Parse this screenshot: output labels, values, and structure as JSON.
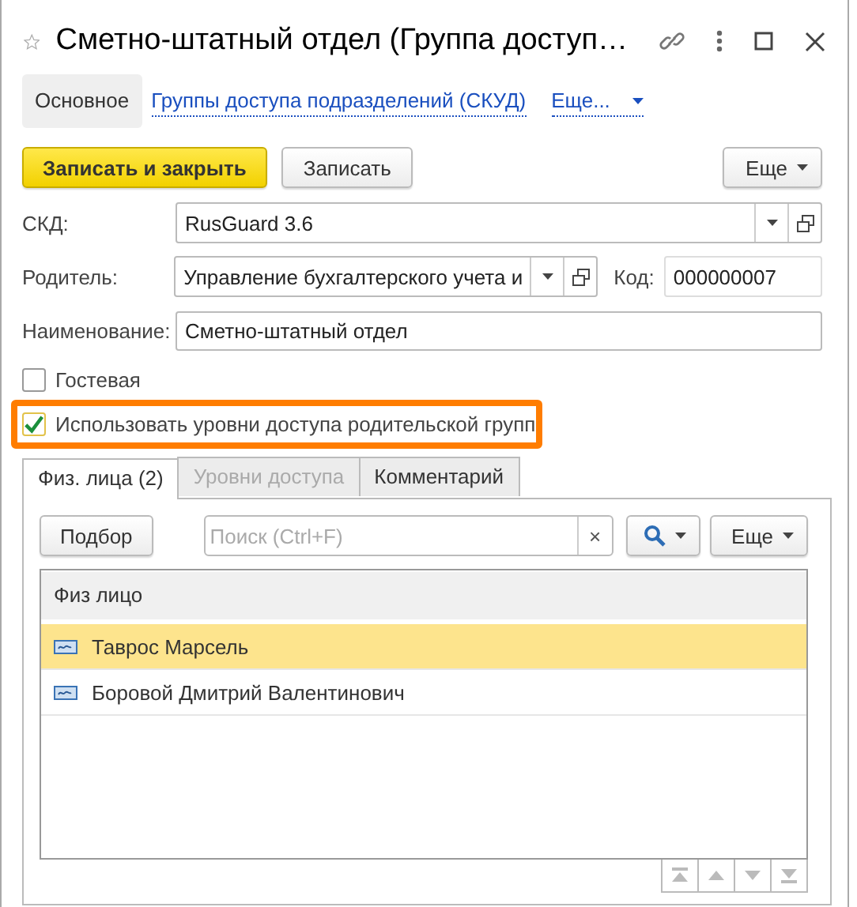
{
  "window": {
    "title": "Сметно-штатный отдел (Группа доступ…"
  },
  "nav": [
    {
      "label": "Основное",
      "selected": true
    },
    {
      "label": "Группы доступа подразделений (СКУД)",
      "selected": false
    }
  ],
  "nav_more": "Еще...",
  "toolbar": {
    "buttons": [
      {
        "label": "Записать и закрыть",
        "kind": "primary"
      },
      {
        "label": "Записать",
        "kind": "normal"
      }
    ],
    "more": "Еще"
  },
  "skd": {
    "label": "СКД:",
    "value": "RusGuard 3.6"
  },
  "parent": {
    "label": "Родитель:",
    "value": "Управление бухгалтерского учета и"
  },
  "code": {
    "label": "Код:",
    "value": "000000007"
  },
  "name": {
    "label": "Наименование:",
    "value": "Сметно-штатный отдел"
  },
  "checkboxes": [
    {
      "label": "Гостевая",
      "checked": false,
      "highlighted": false
    },
    {
      "label": "Использовать уровни доступа родительской групп",
      "checked": true,
      "highlighted": true
    }
  ],
  "tabs": [
    {
      "label": "Физ. лица (2)",
      "selected": true,
      "disabled": false
    },
    {
      "label": "Уровни доступа",
      "selected": false,
      "disabled": true
    },
    {
      "label": "Комментарий",
      "selected": false,
      "disabled": false
    }
  ],
  "panel": {
    "pick_button": "Подбор",
    "search": {
      "placeholder": "Поиск (Ctrl+F)",
      "clear": "×"
    },
    "more": "Еще"
  },
  "table": {
    "columns": [
      "Физ лицо"
    ],
    "rows": [
      {
        "name": "Таврос Марсель",
        "selected": true
      },
      {
        "name": "Боровой Дмитрий Валентинович",
        "selected": false
      }
    ]
  }
}
